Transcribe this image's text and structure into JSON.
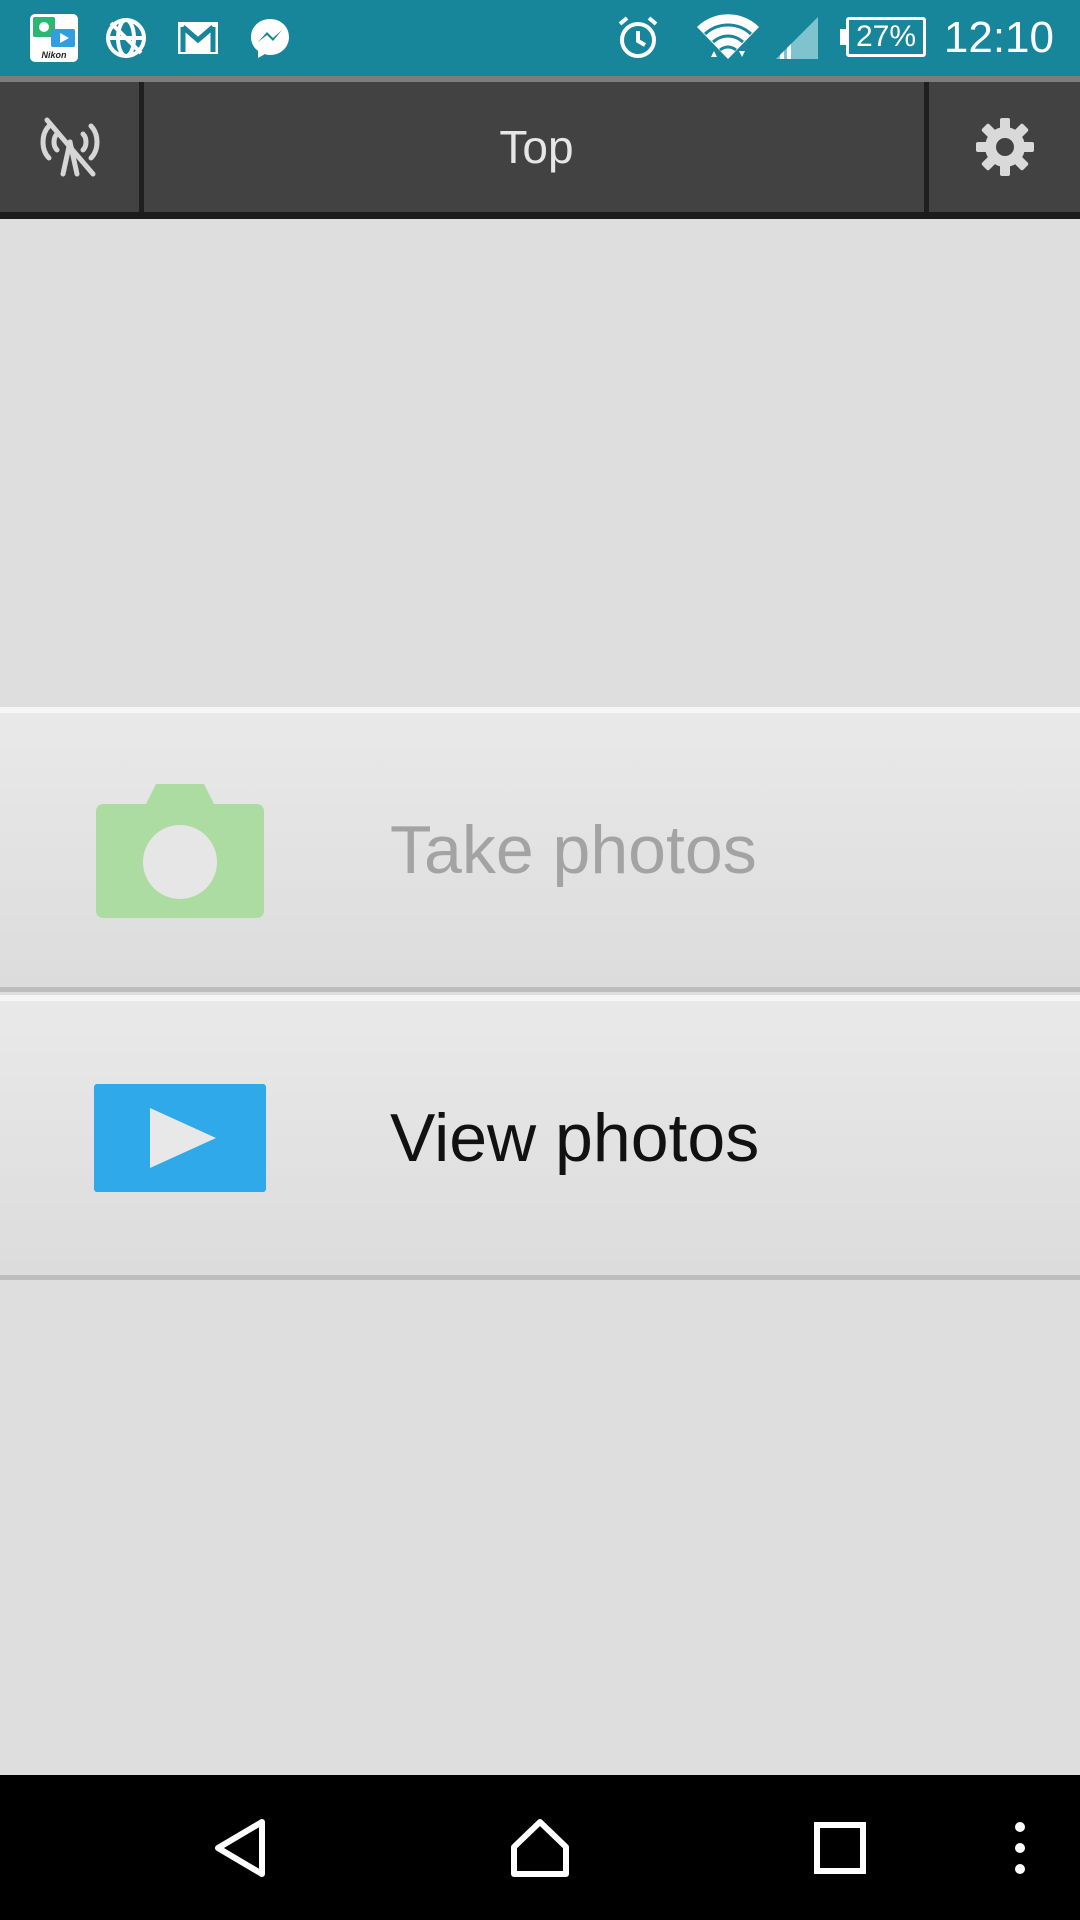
{
  "status_bar": {
    "time": "12:10",
    "battery_percent": "27%",
    "icons": [
      "nikon-app-icon",
      "vpn-globe-icon",
      "gmail-icon",
      "messenger-icon",
      "alarm-icon",
      "wifi-icon",
      "signal-icon"
    ]
  },
  "action_bar": {
    "title": "Top",
    "left_icon": "wireless-off-icon",
    "right_icon": "gear-icon"
  },
  "menu": {
    "take_photos": {
      "label": "Take photos",
      "enabled": false,
      "icon": "camera-icon",
      "icon_color": "#acdca1"
    },
    "view_photos": {
      "label": "View photos",
      "enabled": true,
      "icon": "play-icon",
      "icon_color": "#2fa9e9"
    }
  },
  "nav_bar": {
    "buttons": [
      "back-icon",
      "home-icon",
      "recents-icon",
      "overflow-menu-icon"
    ]
  },
  "colors": {
    "status_bar": "#17869a",
    "action_bar": "#424242",
    "background": "#dedede"
  }
}
